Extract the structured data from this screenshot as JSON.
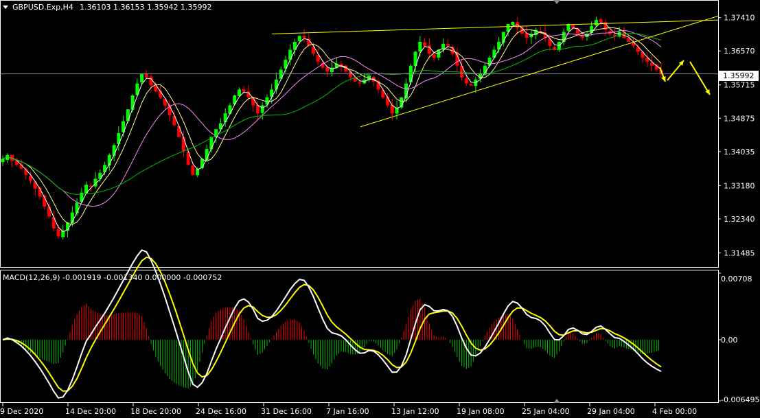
{
  "header": {
    "symbol": "GBPUSD.Exp,H4",
    "ohlc": "1.36103 1.36153 1.35942 1.35992"
  },
  "macd_header": "MACD(12,26,9) -0.001919 -0.001340 0.000000 -0.000752",
  "colors": {
    "background": "#000000",
    "bull_candle": "#00ff00",
    "bear_candle": "#ff0000",
    "axis": "#ffffff",
    "trendline": "#ffff00",
    "ma_fast": "#ffffff",
    "ma_mid": "#ffff99",
    "ma_slow": "#ff88ff",
    "ma_long": "#00c000",
    "macd_line": "#ffffff",
    "signal_line": "#ffff00",
    "hist_pos": "#ff0000",
    "hist_neg": "#00c000",
    "price_line": "#8a8aa8"
  },
  "chart_data": [
    {
      "type": "candlestick",
      "title": "GBPUSD.Exp,H4",
      "current_price": 1.35992,
      "current_price_label": "1.35992",
      "ylim": [
        1.3118,
        1.3775
      ],
      "y_ticks": [
        "1.37410",
        "1.36570",
        "1.35715",
        "1.34875",
        "1.34035",
        "1.33180",
        "1.32340",
        "1.31485"
      ],
      "x_tick_labels": [
        "9 Dec 2020",
        "14 Dec 20:00",
        "18 Dec 20:00",
        "24 Dec 16:00",
        "31 Dec 16:00",
        "7 Jan 16:00",
        "13 Jan 12:00",
        "19 Jan 08:00",
        "25 Jan 04:00",
        "29 Jan 04:00",
        "4 Feb 00:00"
      ],
      "close": [
        1.3385,
        1.3395,
        1.338,
        1.337,
        1.336,
        1.3345,
        1.333,
        1.331,
        1.329,
        1.3265,
        1.324,
        1.321,
        1.319,
        1.3205,
        1.3225,
        1.325,
        1.3275,
        1.33,
        1.332,
        1.3315,
        1.3335,
        1.335,
        1.337,
        1.3395,
        1.342,
        1.345,
        1.348,
        1.351,
        1.3545,
        1.3575,
        1.36,
        1.359,
        1.357,
        1.3555,
        1.354,
        1.352,
        1.3495,
        1.347,
        1.344,
        1.3405,
        1.337,
        1.3345,
        1.336,
        1.3385,
        1.341,
        1.344,
        1.346,
        1.3475,
        1.35,
        1.352,
        1.3545,
        1.356,
        1.3555,
        1.354,
        1.352,
        1.35,
        1.352,
        1.354,
        1.356,
        1.3585,
        1.361,
        1.3635,
        1.366,
        1.368,
        1.3695,
        1.369,
        1.367,
        1.365,
        1.363,
        1.3615,
        1.3605,
        1.3615,
        1.3625,
        1.362,
        1.3605,
        1.359,
        1.358,
        1.3575,
        1.3585,
        1.3595,
        1.358,
        1.356,
        1.354,
        1.352,
        1.35,
        1.3515,
        1.354,
        1.3575,
        1.362,
        1.3655,
        1.368,
        1.367,
        1.365,
        1.364,
        1.366,
        1.3675,
        1.367,
        1.365,
        1.362,
        1.359,
        1.3575,
        1.357,
        1.3585,
        1.36,
        1.362,
        1.364,
        1.366,
        1.368,
        1.3705,
        1.3725,
        1.373,
        1.3715,
        1.37,
        1.369,
        1.37,
        1.371,
        1.3705,
        1.369,
        1.367,
        1.366,
        1.368,
        1.3705,
        1.3725,
        1.3715,
        1.37,
        1.369,
        1.37,
        1.372,
        1.3735,
        1.373,
        1.371,
        1.37,
        1.3695,
        1.3705,
        1.369,
        1.368,
        1.367,
        1.3655,
        1.364,
        1.363,
        1.362,
        1.361,
        1.36
      ],
      "series": [
        {
          "name": "MA fast"
        },
        {
          "name": "MA mid"
        },
        {
          "name": "MA slow"
        },
        {
          "name": "MA long"
        }
      ],
      "annotations": [
        "trendline top",
        "trendline bottom",
        "arrow down",
        "arrow up",
        "arrow down"
      ]
    },
    {
      "type": "macd",
      "title": "MACD(12,26,9) -0.001919 -0.001340 0.000000 -0.000752",
      "ylim": [
        -0.006495,
        0.00708
      ],
      "y_ticks": [
        "0.00708",
        "0.00",
        "-0.006495"
      ]
    }
  ]
}
